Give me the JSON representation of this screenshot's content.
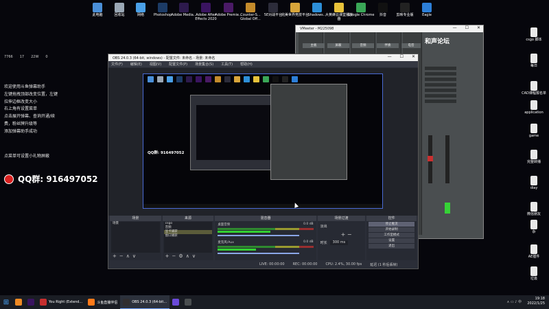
{
  "desktop_top_icons": [
    {
      "label": "此电脑",
      "icon": "computer-icon",
      "color": "#4a8fd8"
    },
    {
      "label": "回收站",
      "icon": "recycle-bin-icon",
      "color": "#9aa7b5"
    },
    {
      "label": "网络",
      "icon": "network-icon",
      "color": "#4aa0e8"
    },
    {
      "label": "Photoshop",
      "icon": "photoshop-icon",
      "color": "#1c3b66"
    },
    {
      "label": "Adobe Media...",
      "icon": "media-encoder-icon",
      "color": "#2d1a4d"
    },
    {
      "label": "Adobe After Effects 2020",
      "icon": "after-effects-icon",
      "color": "#3a1460"
    },
    {
      "label": "Adobe Premie...",
      "icon": "premiere-icon",
      "color": "#4a1a66"
    },
    {
      "label": "Counter-S... Global Off...",
      "icon": "csgo-icon",
      "color": "#c48b2b"
    },
    {
      "label": "5E对战平台",
      "icon": "5e-icon",
      "color": "#2c2c3a"
    },
    {
      "label": "完美世界竞技平台",
      "icon": "perfect-world-icon",
      "color": "#d8a53a"
    },
    {
      "label": "Shadows...",
      "icon": "shadowsocks-icon",
      "color": "#2d8fd8"
    },
    {
      "label": "大黄蜂云课堂播放器",
      "icon": "player-icon",
      "color": "#e8c23a"
    },
    {
      "label": "Google Chrome",
      "icon": "chrome-icon",
      "color": "#3aa757"
    },
    {
      "label": "抖音",
      "icon": "douyin-icon",
      "color": "#111111"
    },
    {
      "label": "剪映专业版",
      "icon": "jianying-icon",
      "color": "#222222"
    },
    {
      "label": "Eagle",
      "icon": "eagle-icon",
      "color": "#2d7fd8"
    }
  ],
  "desktop_right_icons": [
    {
      "label": "csgo 脚本",
      "icon": "document-icon"
    },
    {
      "label": "每日",
      "icon": "document-icon"
    },
    {
      "label": "CAD课程报名单",
      "icon": "document-icon"
    },
    {
      "label": "application",
      "icon": "document-icon"
    },
    {
      "label": "game",
      "icon": "document-icon"
    },
    {
      "label": "完整转播",
      "icon": "document-icon"
    },
    {
      "label": "diay",
      "icon": "document-icon"
    },
    {
      "label": "微信朋友",
      "icon": "document-icon"
    },
    {
      "label": "杂",
      "icon": "document-icon"
    },
    {
      "label": "AE插件",
      "icon": "document-icon"
    },
    {
      "label": "垃圾",
      "icon": "document-icon"
    }
  ],
  "overlay": {
    "stats": [
      "7766",
      "17",
      "22W",
      "0"
    ],
    "lines": [
      "欢迎使用斗鱼弹幕助手",
      "左键拖拽顶部改变位置，左键",
      "拉伸边框改变大小",
      "右上角有设置菜单",
      "点击展开弹幕、查询开通/续",
      "费，粉丝牌升级等",
      "添加弹幕助手成功"
    ],
    "note": "点菜单可设置小礼物屏蔽",
    "qq": "QQ群: 916497052"
  },
  "obs": {
    "title": "OBS 24.0.3 (64-bit, windows) - 配置文件: 未命名 - 场景: 未命名",
    "window_buttons": [
      "—",
      "☐",
      "✕"
    ],
    "menu": [
      "文件(F)",
      "编辑(E)",
      "视图(V)",
      "配置文件(P)",
      "场景集合(S)",
      "工具(T)",
      "帮助(H)"
    ],
    "preview_text": "QQ群: 916497052",
    "docks": {
      "scenes": {
        "title": "场景",
        "items": [
          "场景"
        ]
      },
      "sources": {
        "title": "来源",
        "items": [
          "csgo",
          "音频",
          "显卡捕获",
          "窗口捕获"
        ],
        "selected": 2
      },
      "mixer": {
        "title": "混音器",
        "tracks": [
          {
            "name": "桌面音频",
            "db": "0.0 dB"
          },
          {
            "name": "麦克风/Aux",
            "db": "0.0 dB"
          }
        ]
      },
      "transitions": {
        "title": "场景过渡",
        "type": "淡出",
        "duration_label": "时长",
        "duration": "300 ms"
      },
      "controls": {
        "title": "控件",
        "buttons": [
          "停止推流",
          "开始录制",
          "工作室模式",
          "设置",
          "退出"
        ],
        "active": 0
      }
    },
    "status": [
      "LIVE: 00:00:00",
      "REC: 00:00:00",
      "CPU: 2.4%, 30.00 fps",
      "延迟 (1 秒后丢帧)"
    ]
  },
  "voicemeeter": {
    "title": "VMeeter - M225098",
    "window_buttons": [
      "—",
      "☐",
      "✕"
    ],
    "logo": "和声论坛",
    "tabs": [
      "主板",
      "屏蔽",
      "音频",
      "伴奏",
      "电音"
    ]
  },
  "taskbar": {
    "apps": [
      {
        "label": "",
        "icon": "illustrator-icon",
        "color": "#f08a24"
      },
      {
        "label": "",
        "icon": "after-effects-icon",
        "color": "#3a1460"
      },
      {
        "label": "You Right (Extend...",
        "icon": "netease-music-icon",
        "color": "#c62f2f"
      },
      {
        "label": "斗鱼直播伴侣",
        "icon": "douyu-icon",
        "color": "#ff7a1a"
      },
      {
        "label": "OBS 24.0.3 (64-bit...",
        "icon": "obs-icon",
        "color": "#302e31"
      },
      {
        "label": "",
        "icon": "app-icon",
        "color": "#6a4ad8"
      },
      {
        "label": "",
        "icon": "app-icon",
        "color": "#4a4e50"
      }
    ],
    "active_index": 4,
    "time": "19:18",
    "date": "2022/1/25"
  }
}
